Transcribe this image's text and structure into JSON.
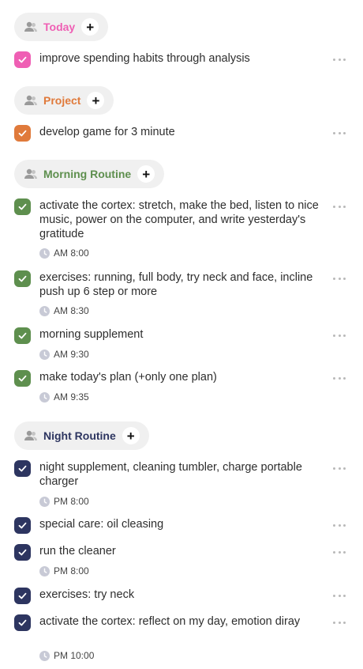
{
  "colors": {
    "today": "#ef5fb4",
    "project": "#e07a3b",
    "morning": "#5e8f4e",
    "night": "#2d3560"
  },
  "icons": {
    "group": "people-icon",
    "add": "plus-icon",
    "check": "checkmark-icon",
    "more": "more-dots-icon",
    "time": "clock-icon"
  },
  "groups": [
    {
      "name": "Today",
      "add_label": "+",
      "tasks": [
        {
          "title": "improve spending habits through analysis",
          "time": ""
        }
      ]
    },
    {
      "name": "Project",
      "add_label": "+",
      "tasks": [
        {
          "title": "develop game for 3 minute",
          "time": ""
        }
      ]
    },
    {
      "name": "Morning Routine",
      "add_label": "+",
      "tasks": [
        {
          "title": "activate the cortex: stretch, make the bed, listen to nice music, power on the computer, and write yesterday's gratitude",
          "time": "AM 8:00"
        },
        {
          "title": "exercises: running, full body, try neck and face, incline push up 6 step or more",
          "time": "AM 8:30"
        },
        {
          "title": "morning supplement",
          "time": "AM 9:30"
        },
        {
          "title": "make today's plan (+only one plan)",
          "time": "AM 9:35"
        }
      ]
    },
    {
      "name": "Night Routine",
      "add_label": "+",
      "tasks": [
        {
          "title": "night supplement, cleaning tumbler, charge portable charger",
          "time": "PM 8:00"
        },
        {
          "title": "special care: oil cleasing",
          "time": ""
        },
        {
          "title": "run the cleaner",
          "time": "PM 8:00"
        },
        {
          "title": "exercises: try neck",
          "time": ""
        },
        {
          "title": "activate the cortex: reflect on my day, emotion diray",
          "time": "PM 10:00"
        }
      ]
    }
  ]
}
